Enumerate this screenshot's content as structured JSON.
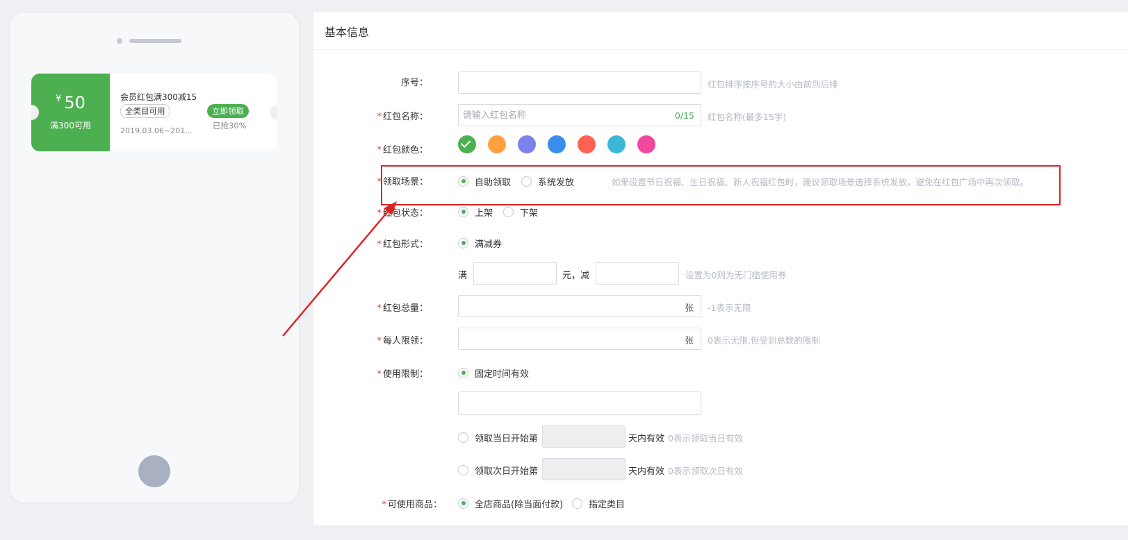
{
  "preview": {
    "coupon": {
      "currency": "¥",
      "amount": "50",
      "condition": "满300可用",
      "name": "会员红包满300减15",
      "scope": "全类目可用",
      "grab_button": "立即领取",
      "date": "2019.03.06~201...",
      "grabbed": "已抢30%"
    }
  },
  "panel": {
    "title": "基本信息"
  },
  "form": {
    "serial": {
      "label": "序号：",
      "value": "",
      "hint": "红包排序按序号的大小由前到后排"
    },
    "name": {
      "label": "红包名称：",
      "placeholder": "请输入红包名称",
      "counter": "0/15",
      "hint": "红包名称(最多15字)"
    },
    "color": {
      "label": "红包颜色：",
      "options": [
        "#4cb050",
        "#ffa040",
        "#7b83ea",
        "#3b8ded",
        "#ff6152",
        "#3cb8d6",
        "#f2479e"
      ],
      "selected_index": 0
    },
    "scene": {
      "label": "领取场景：",
      "options": [
        "自助领取",
        "系统发放"
      ],
      "selected": "自助领取",
      "hint": "如果设置节日祝福、生日祝福、新人祝福红包时，建议领取场景选择系统发放，避免在红包广场中再次领取。"
    },
    "status": {
      "label": "红包状态：",
      "options": [
        "上架",
        "下架"
      ],
      "selected": "上架"
    },
    "form_type": {
      "label": "红包形式：",
      "options": [
        "满减券"
      ],
      "selected": "满减券"
    },
    "threshold": {
      "prefix": "满",
      "middle": "元，减",
      "hint": "设置为0则为无门槛使用券"
    },
    "total": {
      "label": "红包总量：",
      "suffix": "张",
      "hint": "-1表示无限"
    },
    "per_person": {
      "label": "每人限领：",
      "suffix": "张",
      "hint": "0表示无限,但受到总数的限制"
    },
    "usage": {
      "label": "使用限制：",
      "fixed": "固定时间有效",
      "same_day_prefix": "领取当日开始第",
      "same_day_suffix": "天内有效",
      "same_day_hint": "0表示领取当日有效",
      "next_day_prefix": "领取次日开始第",
      "next_day_suffix": "天内有效",
      "next_day_hint": "0表示领取次日有效"
    },
    "goods": {
      "label": "可使用商品：",
      "options": [
        "全店商品(除当面付款)",
        "指定类目"
      ],
      "selected": "全店商品(除当面付款)"
    }
  },
  "annotation_color": "#e32020"
}
